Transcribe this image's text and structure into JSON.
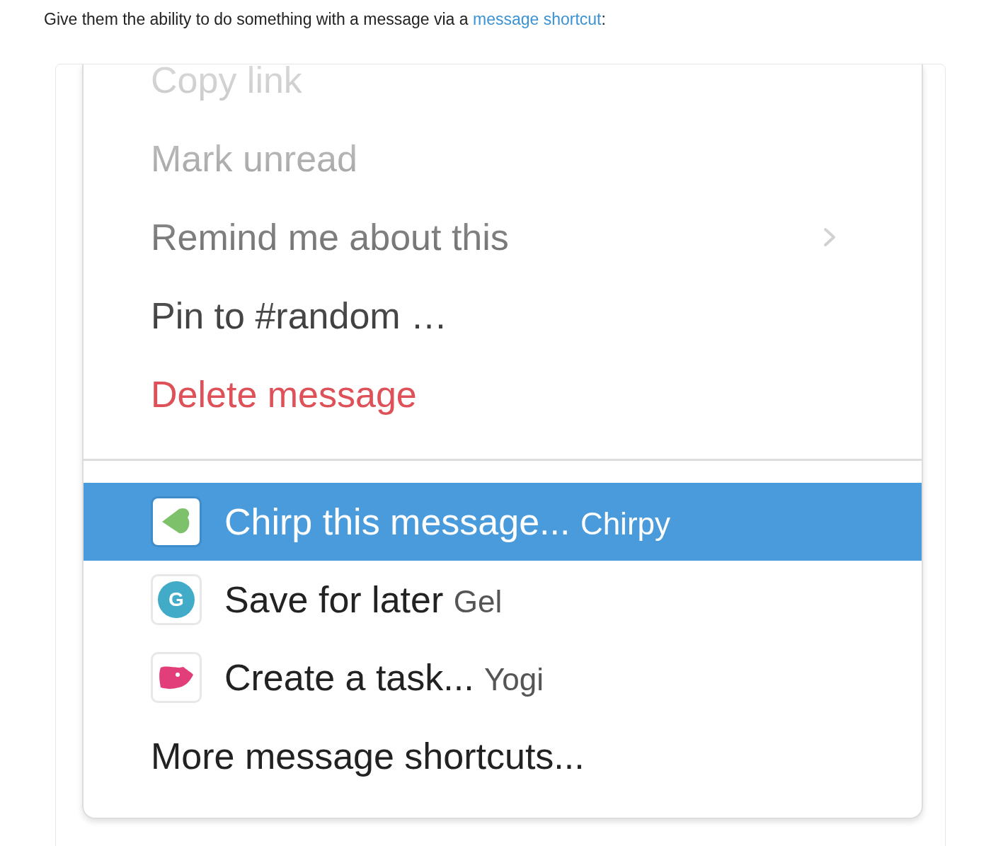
{
  "intro": {
    "before": "Give them the ability to do something with a message via a ",
    "link": "message shortcut",
    "after": ":"
  },
  "menu": {
    "actions": [
      {
        "label": "Copy link",
        "kind": "action"
      },
      {
        "label": "Mark unread",
        "kind": "action"
      },
      {
        "label": "Remind me about this",
        "kind": "submenu"
      },
      {
        "label": "Pin to #random …",
        "kind": "action"
      },
      {
        "label": "Delete message",
        "kind": "danger"
      }
    ],
    "shortcuts": [
      {
        "label": "Chirp this message...",
        "app": "Chirpy",
        "kind": "heart",
        "selected": true
      },
      {
        "label": "Save for later",
        "app": "Gel",
        "kind": "letter",
        "icon_text": "G",
        "selected": false
      },
      {
        "label": "Create a task...",
        "app": "Yogi",
        "kind": "blob",
        "selected": false
      }
    ],
    "more": "More message shortcuts..."
  }
}
